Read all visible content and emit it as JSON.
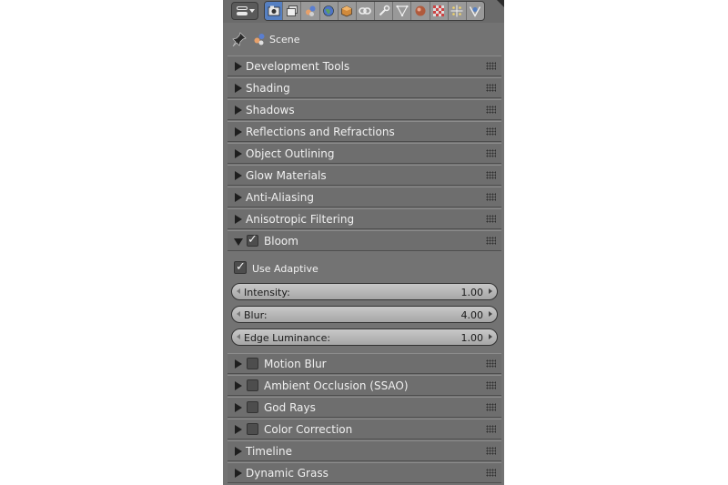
{
  "header": {
    "editor_type_icon": "properties-editor-icon",
    "tabs": [
      {
        "icon": "render-icon",
        "active": true
      },
      {
        "icon": "render-layers-icon",
        "active": false
      },
      {
        "icon": "scene-icon",
        "active": false
      },
      {
        "icon": "world-icon",
        "active": false
      },
      {
        "icon": "object-icon",
        "active": false
      },
      {
        "icon": "constraints-icon",
        "active": false
      },
      {
        "icon": "modifiers-icon",
        "active": false
      },
      {
        "icon": "data-icon",
        "active": false
      },
      {
        "icon": "material-icon",
        "active": false
      },
      {
        "icon": "texture-icon",
        "active": false
      },
      {
        "icon": "particles-icon",
        "active": false
      },
      {
        "icon": "physics-icon",
        "active": false
      }
    ]
  },
  "context": {
    "scene_label": "Scene"
  },
  "panels": {
    "development_tools": "Development Tools",
    "shading": "Shading",
    "shadows": "Shadows",
    "reflections": "Reflections and Refractions",
    "object_outlining": "Object Outlining",
    "glow_materials": "Glow Materials",
    "anti_aliasing": "Anti-Aliasing",
    "anisotropic": "Anisotropic Filtering",
    "bloom": "Bloom",
    "motion_blur": "Motion Blur",
    "ssao": "Ambient Occlusion (SSAO)",
    "god_rays": "God Rays",
    "color_correction": "Color Correction",
    "timeline": "Timeline",
    "dynamic_grass": "Dynamic Grass"
  },
  "bloom": {
    "enabled": true,
    "use_adaptive_label": "Use Adaptive",
    "use_adaptive": true,
    "intensity_label": "Intensity:",
    "intensity_value": "1.00",
    "blur_label": "Blur:",
    "blur_value": "4.00",
    "edge_label": "Edge Luminance:",
    "edge_value": "1.00"
  },
  "toggles": {
    "motion_blur": false,
    "ssao": false,
    "god_rays": false,
    "color_correction": false
  },
  "check_glyph": "✓",
  "colors": {
    "panel_bg": "#737373",
    "active_tab": "#5680c2",
    "slider_fill": "#b8b8b8"
  }
}
